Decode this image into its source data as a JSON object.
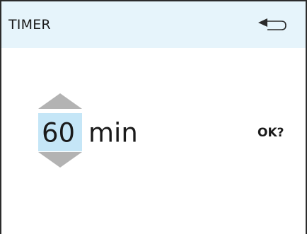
{
  "header": {
    "title": "TIMER",
    "back_icon": "back-arrow-icon"
  },
  "timer": {
    "value": "60",
    "unit": "min",
    "increment_icon": "triangle-up-icon",
    "decrement_icon": "triangle-down-icon"
  },
  "actions": {
    "ok_label": "OK?"
  },
  "colors": {
    "header_bg": "#e6f4fb",
    "value_highlight": "#c5e6f7",
    "arrow_fill": "#b3b3b3",
    "frame": "#2b2b2b"
  }
}
